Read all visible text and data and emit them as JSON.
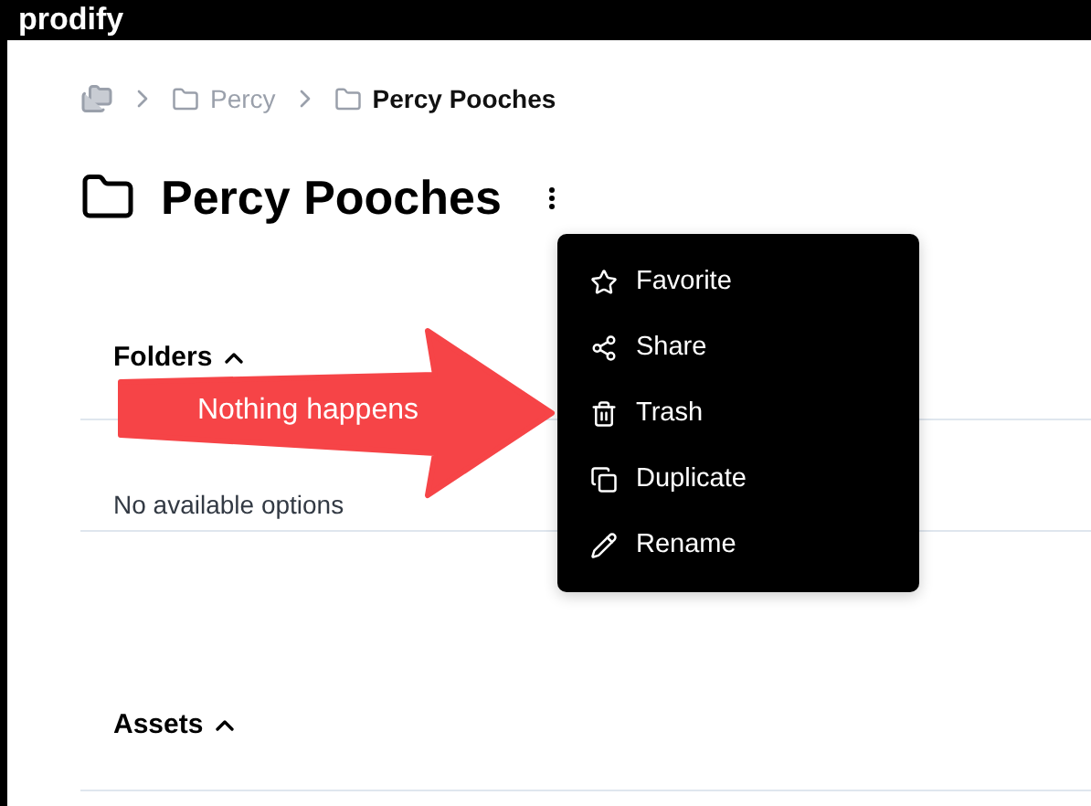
{
  "header": {
    "logo": "prodify"
  },
  "breadcrumb": [
    {
      "kind": "root"
    },
    {
      "kind": "folder",
      "label": "Percy",
      "current": false
    },
    {
      "kind": "folder",
      "label": "Percy Pooches",
      "current": true
    }
  ],
  "title": "Percy Pooches",
  "menu": [
    {
      "kind": "favorite",
      "label": "Favorite"
    },
    {
      "kind": "share",
      "label": "Share"
    },
    {
      "kind": "trash",
      "label": "Trash"
    },
    {
      "kind": "duplicate",
      "label": "Duplicate"
    },
    {
      "kind": "rename",
      "label": "Rename"
    }
  ],
  "sections": [
    {
      "title": "Folders",
      "expanded": true,
      "empty_text": "No available options"
    },
    {
      "title": "Assets",
      "expanded": true
    }
  ],
  "annotation": {
    "text": "Nothing happens"
  }
}
